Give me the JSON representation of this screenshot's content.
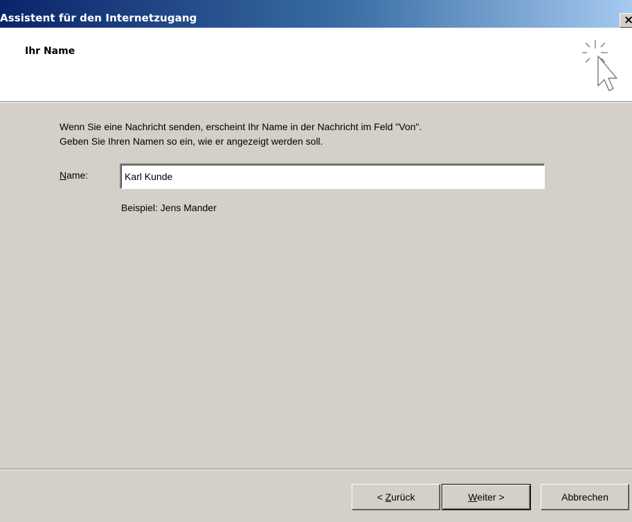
{
  "window": {
    "title": "Assistent für den Internetzugang",
    "close_label": "×"
  },
  "header": {
    "title": "Ihr Name",
    "icon": "wizard-sparkle-cursor-icon"
  },
  "content": {
    "intro_line1": "Wenn Sie eine Nachricht senden, erscheint Ihr Name in der Nachricht im Feld \"Von\".",
    "intro_line2": "Geben Sie Ihren Namen so ein, wie er angezeigt werden soll.",
    "name_label_accel": "N",
    "name_label_rest": "ame:",
    "name_value": "Karl Kunde",
    "example": "Beispiel: Jens Mander"
  },
  "buttons": {
    "back_prefix": "< ",
    "back_accel": "Z",
    "back_rest": "urück",
    "next_accel": "W",
    "next_rest": "eiter >",
    "cancel": "Abbrechen"
  },
  "colors": {
    "titlebar_start": "#0a246a",
    "titlebar_end": "#a6caf0",
    "dialog_face": "#d4d0c8",
    "header_bg": "#ffffff"
  }
}
